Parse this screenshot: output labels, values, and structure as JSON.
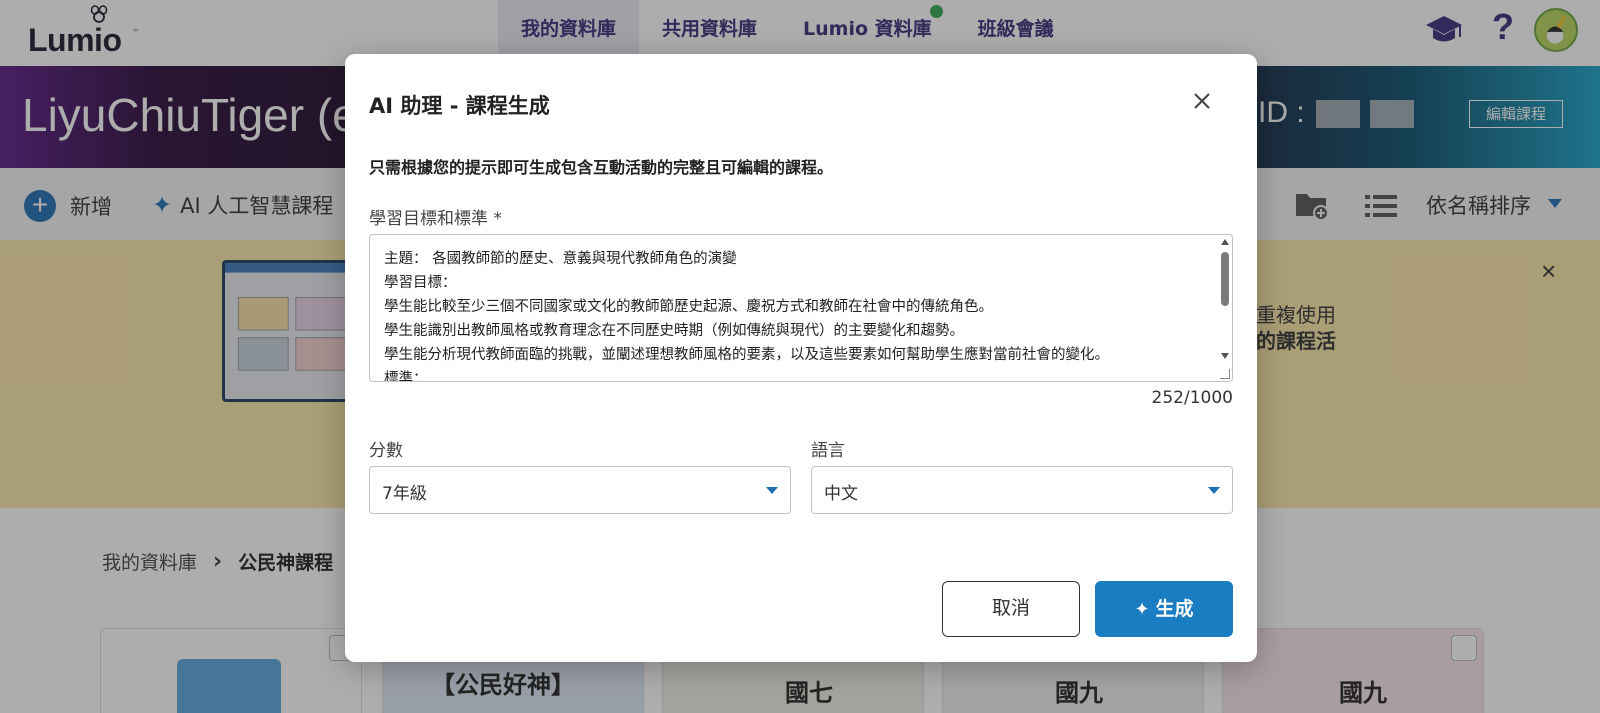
{
  "app": {
    "logo_text": "Lumio",
    "logo_tm": "™",
    "nav": [
      {
        "label": "我的資料庫",
        "active": true
      },
      {
        "label": "共用資料庫",
        "active": false
      },
      {
        "label": "Lumio 資料庫",
        "active": false,
        "has_dot": true
      },
      {
        "label": "班級會議",
        "active": false
      }
    ],
    "icons": {
      "cap": "graduation-cap-icon",
      "help": "?",
      "avatar": "user-avatar"
    }
  },
  "banner": {
    "course_title": "LiyuChiuTiger (e",
    "course_id_label": "ID :",
    "edit_button": "編輯課程"
  },
  "toolbar": {
    "add_label": "新增",
    "ai_label": "AI 人工智慧課程",
    "sort_label": "依名稱排序"
  },
  "promo": {
    "text_line1": "地重複使用",
    "text_line2": "新的課程活",
    "close": "×"
  },
  "breadcrumb": {
    "root": "我的資料庫",
    "current": "公民神課程"
  },
  "cards": [
    {
      "type": "folder"
    },
    {
      "type": "image",
      "text": "【公民好神】"
    },
    {
      "type": "image",
      "text": "國七"
    },
    {
      "type": "image",
      "text": "國九"
    },
    {
      "type": "image",
      "text": "國九"
    }
  ],
  "modal": {
    "title": "AI 助理  - 課程生成",
    "description": "只需根據您的提示即可生成包含互動活動的完整且可編輯的課程。",
    "objectives_label": "學習目標和標準 *",
    "objectives_lines": [
      "主題： 各國教師節的歷史、意義與現代教師角色的演變",
      "學習目標：",
      "學生能比較至少三個不同國家或文化的教師節歷史起源、慶祝方式和教師在社會中的傳統角色。",
      "學生能識別出教師風格或教育理念在不同歷史時期（例如傳統與現代）的主要變化和趨勢。",
      "學生能分析現代教師面臨的挑戰，並闡述理想教師風格的要素，以及這些要素如何幫助學生應對當前社會的變化。",
      "標準："
    ],
    "char_count": "252/1000",
    "grade_label": "分數",
    "grade_value": "7年級",
    "language_label": "語言",
    "language_value": "中文",
    "cancel_label": "取消",
    "generate_label": "生成"
  },
  "colors": {
    "primary": "#1a7cc1",
    "nav_text": "#3b2a7a",
    "promo_bg": "#fbe7a6",
    "status_dot": "#34a853"
  }
}
